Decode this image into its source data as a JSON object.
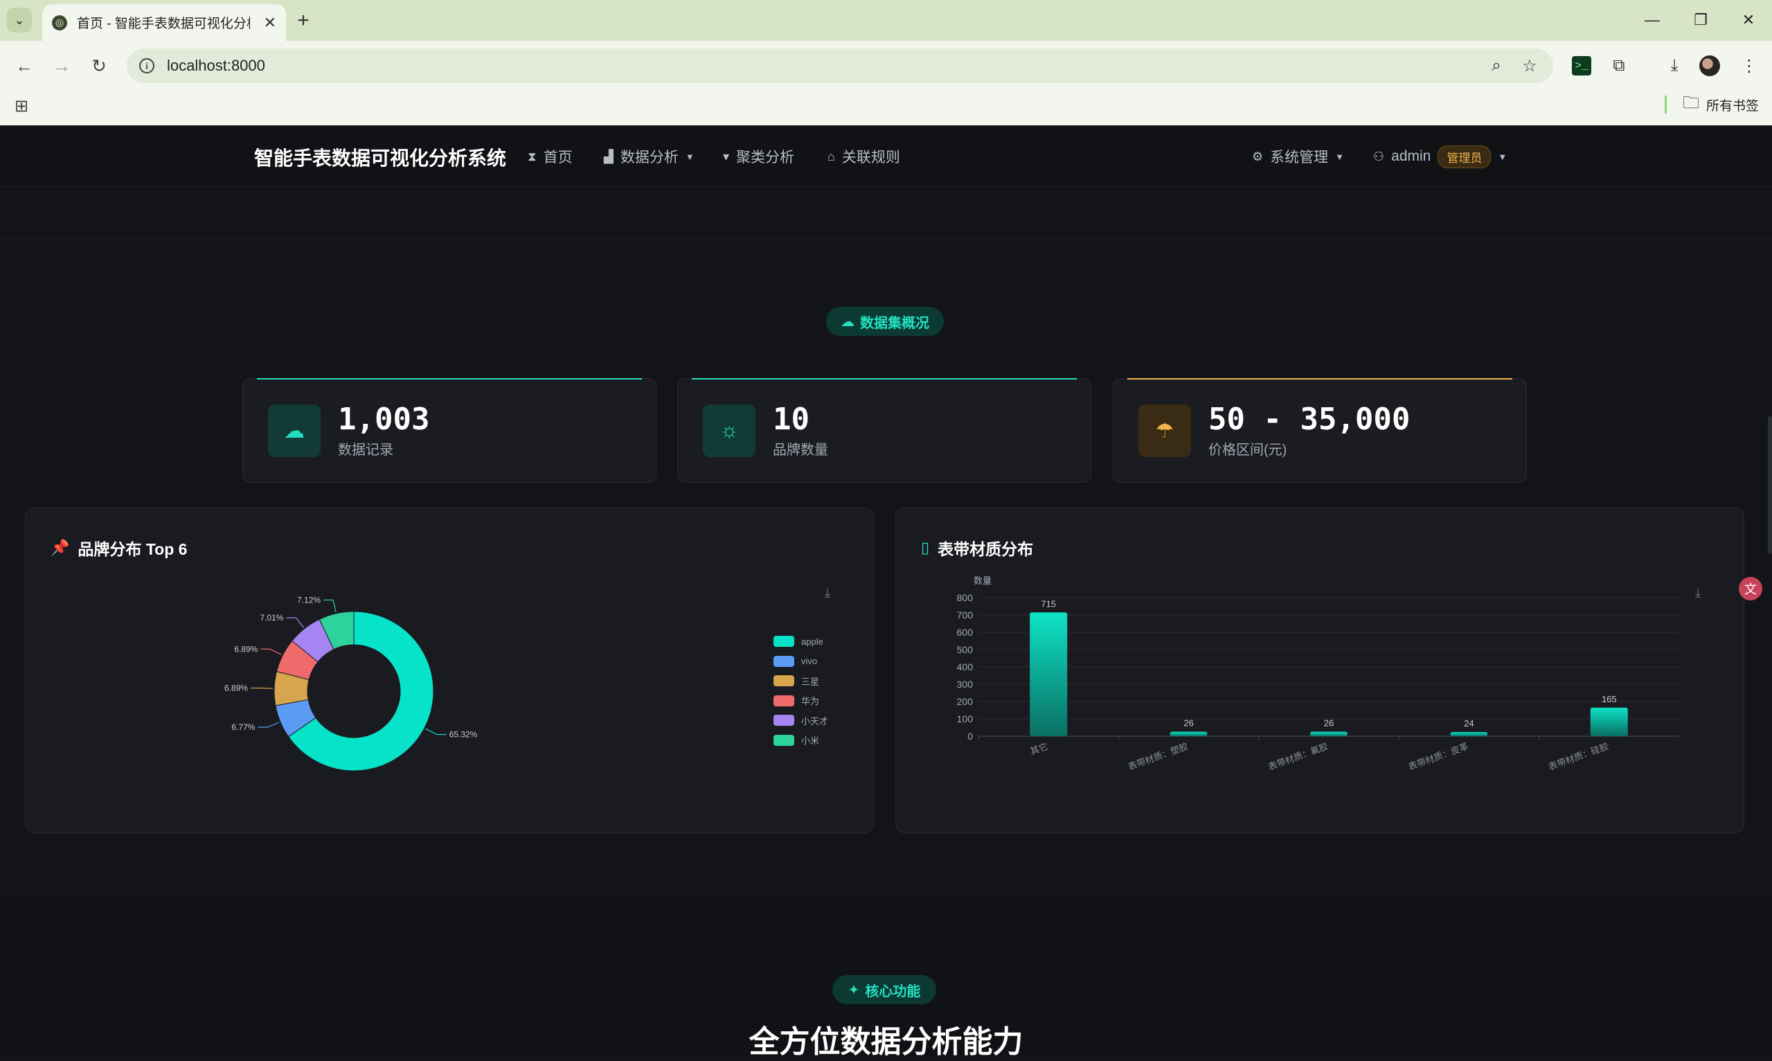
{
  "browser": {
    "tab_title": "首页 - 智能手表数据可视化分析",
    "url": "localhost:8000",
    "bookmarks_folder": "所有书签"
  },
  "nav": {
    "brand": "智能手表数据可视化分析系统",
    "items": [
      {
        "label": "首页",
        "icon": "hourglass-icon"
      },
      {
        "label": "数据分析",
        "icon": "bar-chart-icon",
        "dropdown": true
      },
      {
        "label": "聚类分析",
        "icon": "thumbs-down-icon"
      },
      {
        "label": "关联规则",
        "icon": "gamepad-icon"
      }
    ],
    "system": "系统管理",
    "user": "admin",
    "role": "管理员"
  },
  "overview": {
    "badge": "数据集概况",
    "stats": [
      {
        "value": "1,003",
        "label": "数据记录",
        "icon": "cloud-snow-icon",
        "color": "#23e0c2"
      },
      {
        "value": "10",
        "label": "品牌数量",
        "icon": "sun-icon",
        "color": "#23e0c2"
      },
      {
        "value": "50 - 35,000",
        "label": "价格区间(元)",
        "icon": "cloud-rain-icon",
        "color": "#f2b34a"
      }
    ]
  },
  "brand_panel": {
    "title": "品牌分布 Top 6",
    "icon": "pin-icon"
  },
  "material_panel": {
    "title": "表带材质分布",
    "icon": "sidebar-icon"
  },
  "chart_data": [
    {
      "type": "pie",
      "title": "品牌分布 Top 6",
      "labels": [
        "apple",
        "vivo",
        "三星",
        "华为",
        "小天才",
        "小米"
      ],
      "values": [
        65.32,
        6.77,
        6.89,
        6.89,
        7.01,
        7.12
      ],
      "value_labels": [
        "65.32%",
        "6.77%",
        "6.89%",
        "6.89%",
        "7.01%",
        "7.12%"
      ],
      "colors": [
        "#07e3c8",
        "#5b9bf4",
        "#d6a54e",
        "#ef6b6b",
        "#a685f2",
        "#2ed39b"
      ],
      "donut": true,
      "legend": "right"
    },
    {
      "type": "bar",
      "title": "表带材质分布",
      "ylabel": "数量",
      "categories": [
        "其它",
        "表带材质：塑胶",
        "表带材质：氟胶",
        "表带材质：皮革",
        "表带材质：硅胶"
      ],
      "values": [
        715,
        26,
        26,
        24,
        165
      ],
      "ylim": [
        0,
        800
      ],
      "yticks": [
        0,
        100,
        200,
        300,
        400,
        500,
        600,
        700,
        800
      ],
      "grid": true,
      "color": "#07c9b1"
    }
  ],
  "features": {
    "badge": "核心功能",
    "heading": "全方位数据分析能力"
  }
}
